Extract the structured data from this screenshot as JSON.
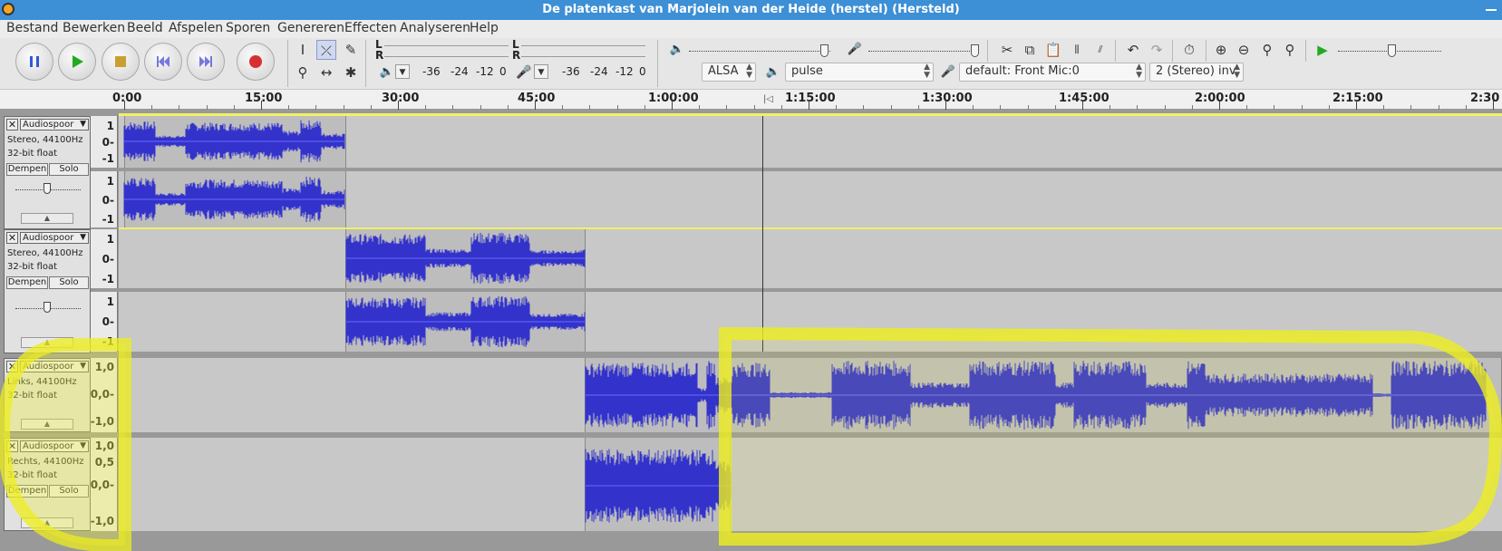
{
  "window": {
    "title": "De platenkast van Marjolein van der Heide  (herstel) (Hersteld)"
  },
  "menu": [
    "Bestand",
    "Bewerken",
    "Beeld",
    "Afspelen",
    "Sporen",
    "Genereren",
    "Effecten",
    "Analyseren",
    "Help"
  ],
  "meters": {
    "record_scale": [
      "-36",
      "-24",
      "-12",
      "0"
    ],
    "play_scale": [
      "-36",
      "-24",
      "-12",
      "0"
    ],
    "channel_l": "L",
    "channel_r": "R"
  },
  "devices": {
    "host": "ALSA",
    "playback": "pulse",
    "recording": "default: Front Mic:0",
    "channels": "2 (Stereo) inv"
  },
  "timeline": {
    "labels": [
      "0:00",
      "15:00",
      "30:00",
      "45:00",
      "1:00:00",
      "1:15:00",
      "1:30:00",
      "1:45:00",
      "2:00:00",
      "2:15:00",
      "2:30"
    ]
  },
  "tracks": [
    {
      "name": "Audiospoor",
      "info1": "Stereo, 44100Hz",
      "info2": "32-bit float",
      "mute": "Dempen",
      "solo": "Solo",
      "scale": [
        "1",
        "0-",
        "-1"
      ]
    },
    {
      "name": "Audiospoor",
      "info1": "Stereo, 44100Hz",
      "info2": "32-bit float",
      "mute": "Dempen",
      "solo": "Solo",
      "scale": [
        "1",
        "0-",
        "-1"
      ]
    },
    {
      "name": "Audiospoor",
      "info1": "Links, 44100Hz",
      "info2": "32-bit float",
      "scale": [
        "1,0",
        "0,0-",
        "-1,0"
      ]
    },
    {
      "name": "Audiospoor",
      "info1": "Rechts, 44100Hz",
      "info2": "32-bit float",
      "mute": "Dempen",
      "solo": "Solo",
      "scale": [
        "1,0",
        "0,5",
        "0,0-",
        "-1,0"
      ]
    }
  ],
  "colors": {
    "waveform": "#3333cc",
    "highlight": "#f0f000",
    "titlebar": "#3d8fd6"
  }
}
